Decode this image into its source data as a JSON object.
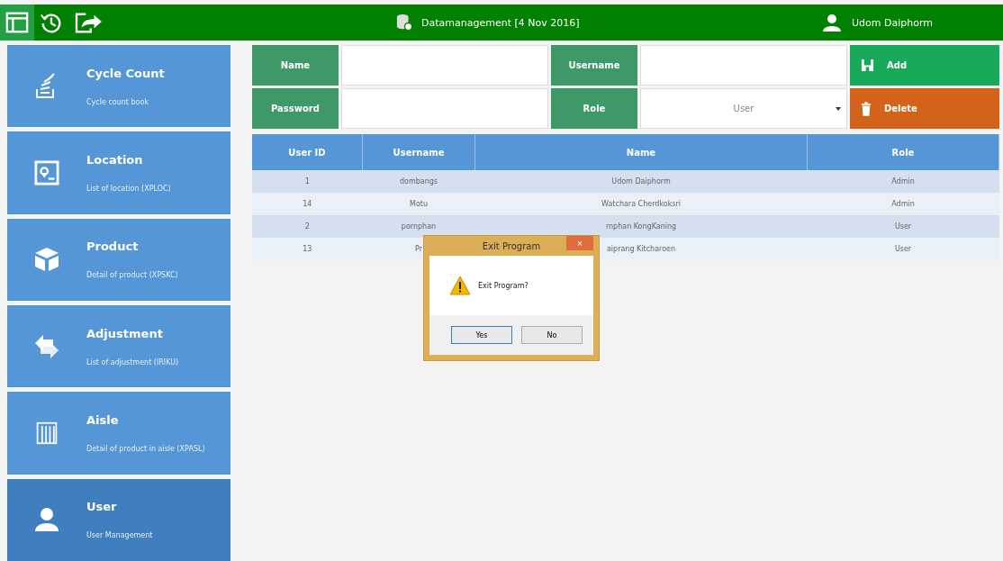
{
  "toolbar": [
    {
      "kind": "table",
      "selected": true
    },
    {
      "kind": "history",
      "selected": false
    },
    {
      "kind": "exit",
      "selected": false
    }
  ],
  "header": {
    "title": "Datamanagement [4 Nov 2016]",
    "user": "Udom  Daiphorm"
  },
  "sidebar": {
    "items": [
      {
        "kind": "cycle",
        "title": "Cycle Count",
        "subtitle": "Cycle count book",
        "selected": false
      },
      {
        "kind": "location",
        "title": "Location",
        "subtitle": "List of location (XPLOC)",
        "selected": false
      },
      {
        "kind": "box",
        "title": "Product",
        "subtitle": "Detail of product  (XPSKC)",
        "selected": false
      },
      {
        "kind": "swap",
        "title": "Adjustment",
        "subtitle": "List of adjustment (IRIKU)",
        "selected": false
      },
      {
        "kind": "aisle",
        "title": "Aisle",
        "subtitle": "Detail of product in aisle (XPASL)",
        "selected": false
      },
      {
        "kind": "user",
        "title": "User",
        "subtitle": "User Management",
        "selected": true
      }
    ]
  },
  "form": {
    "name_label": "Name",
    "username_label": "Username",
    "password_label": "Password",
    "role_label": "Role",
    "role_value": "User",
    "add": "Add",
    "delete": "Delete"
  },
  "table": {
    "columns": [
      "User ID",
      "Username",
      "Name",
      "Role"
    ],
    "rows": [
      [
        "1",
        "dombangs",
        "Udom Daiphorm",
        "Admin"
      ],
      [
        "14",
        "Motu",
        "Watchara Cherdkoksri",
        "Admin"
      ],
      [
        "2",
        "pornphan",
        "rnphan KongKaning",
        "User"
      ],
      [
        "13",
        "Pr",
        "aiprang Kitcharoen",
        "User"
      ]
    ]
  },
  "dialog": {
    "title": "Exit Program",
    "close": "×",
    "message": "Exit Program?",
    "buttons": [
      "Yes",
      "No"
    ]
  }
}
